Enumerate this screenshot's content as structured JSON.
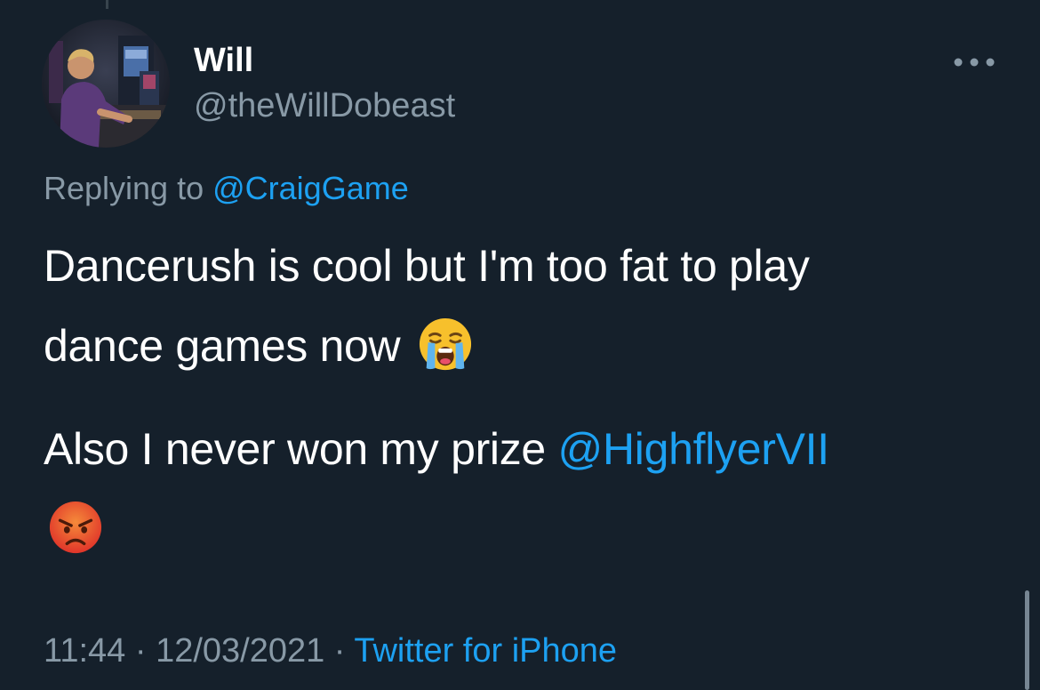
{
  "tweet": {
    "author": {
      "display_name": "Will",
      "handle": "@theWillDobeast"
    },
    "reply": {
      "prefix": "Replying to",
      "to_handle": "@CraigGame"
    },
    "text": {
      "line1": "Dancerush is cool but I'm too fat to play",
      "line2": "dance games now",
      "line3_text": "Also I never won my prize",
      "line3_mention": "@HighflyerVII"
    },
    "emojis": {
      "first": "loudly-crying-face",
      "second": "angry-face"
    },
    "meta": {
      "time": "11:44",
      "separator": " · ",
      "date": "12/03/2021",
      "source": "Twitter for iPhone"
    }
  },
  "icons": {
    "more": "more-horizontal-icon"
  },
  "colors": {
    "background": "#15202b",
    "text": "#ffffff",
    "muted": "#8899a6",
    "link": "#1da1f2"
  }
}
